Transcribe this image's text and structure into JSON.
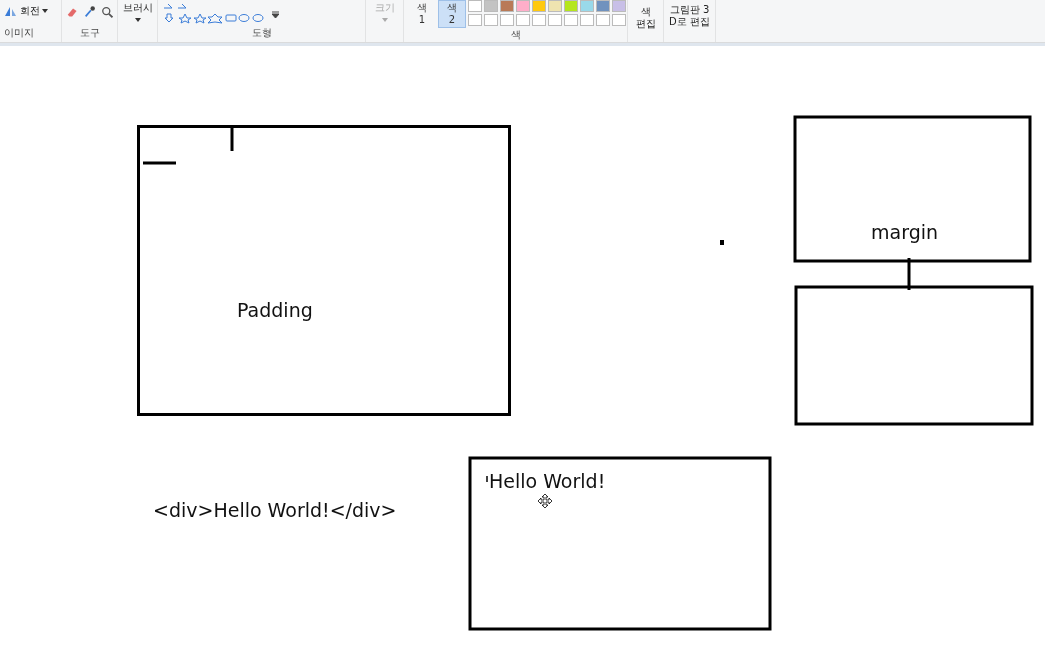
{
  "ribbon": {
    "rotate_button": "회전",
    "image_group": "이미지",
    "tools_group": "도구",
    "brush_button": "브러시",
    "shapes_group": "도형",
    "size_button": {
      "label": "크기",
      "disabled": true
    },
    "color_buttons": [
      {
        "label": "색 1",
        "selected": false
      },
      {
        "label": "색 2",
        "selected": true
      }
    ],
    "palette": [
      {
        "color": "#ffffff"
      },
      {
        "color": "#c3c3c3"
      },
      {
        "color": "#b97a57"
      },
      {
        "color": "#ffaec9"
      },
      {
        "color": "#ffc90e"
      },
      {
        "color": "#efe4b0"
      },
      {
        "color": "#b5e61d"
      },
      {
        "color": "#99d9ea"
      },
      {
        "color": "#7092be"
      },
      {
        "color": "#c8bfe7"
      },
      {
        "color": "#ffffff"
      },
      {
        "color": "#ffffff"
      },
      {
        "color": "#ffffff"
      },
      {
        "color": "#ffffff"
      },
      {
        "color": "#ffffff"
      },
      {
        "color": "#ffffff"
      },
      {
        "color": "#ffffff"
      },
      {
        "color": "#ffffff"
      },
      {
        "color": "#ffffff"
      },
      {
        "color": "#ffffff"
      }
    ],
    "colors_group": "색",
    "edit_colors_button": "색 편집",
    "paint3d_button": [
      "그림판 3",
      "D로 편집"
    ]
  },
  "canvas": {
    "texts": [
      "Padding",
      "margin",
      "<div>Hello World!</div>",
      "Hello World!"
    ]
  }
}
